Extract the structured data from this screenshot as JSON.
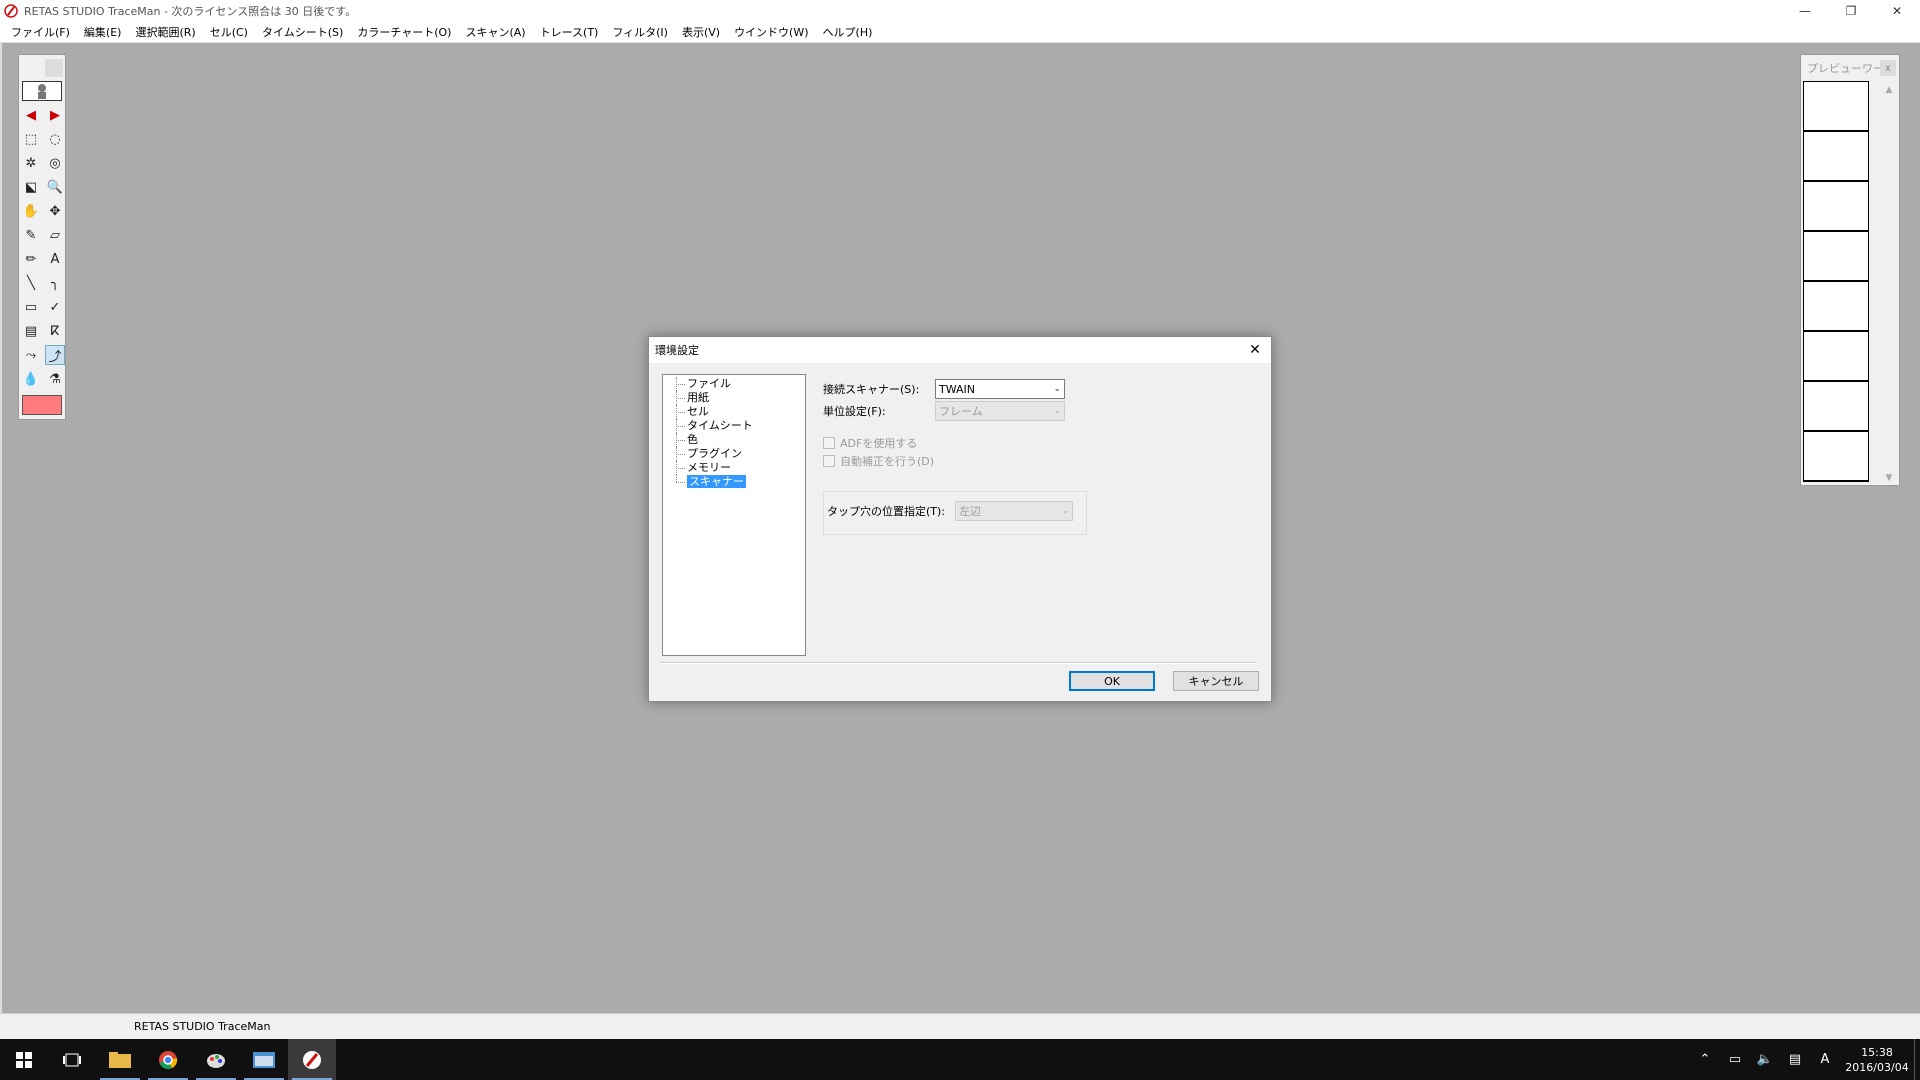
{
  "window": {
    "title": "RETAS STUDIO TraceMan - 次のライセンス照合は 30 日後です。",
    "controls": {
      "minimize": "—",
      "restore": "❐",
      "close": "✕"
    }
  },
  "menu": [
    "ファイル(F)",
    "編集(E)",
    "選択範囲(R)",
    "セル(C)",
    "タイムシート(S)",
    "カラーチャート(O)",
    "スキャン(A)",
    "トレース(T)",
    "フィルタ(I)",
    "表示(V)",
    "ウインドウ(W)",
    "ヘルプ(H)"
  ],
  "toolbox": {
    "tools": [
      "◀",
      "▶",
      "⬚",
      "◌",
      "✲",
      "◎",
      "⬕",
      "🔍",
      "✋",
      "✥",
      "✎",
      "▱",
      "✏",
      "A",
      "╲",
      "╮",
      "▭",
      "✓",
      "▤",
      "ⴽ",
      "⤳",
      "⤴",
      "💧",
      "⚗"
    ],
    "color": "#ff7b7b"
  },
  "previewer": {
    "title": "プレビューワー",
    "close": "x",
    "frame_count": 8,
    "scroll_up": "▲",
    "scroll_down": "▼"
  },
  "status": {
    "text": "RETAS STUDIO TraceMan"
  },
  "dialog": {
    "title": "環境設定",
    "close": "✕",
    "tree": [
      "ファイル",
      "用紙",
      "セル",
      "タイムシート",
      "色",
      "プラグイン",
      "メモリー",
      "スキャナー"
    ],
    "selected_index": 7,
    "scanner_label": "接続スキャナー(S):",
    "scanner_value": "TWAIN",
    "unit_label": "単位設定(F):",
    "unit_value": "フレーム",
    "adf_label": "ADFを使用する",
    "auto_label": "自動補正を行う(D)",
    "tap_label": "タップ穴の位置指定(T):",
    "tap_value": "左辺",
    "ok": "OK",
    "cancel": "キャンセル"
  },
  "taskbar": {
    "clock_time": "15:38",
    "clock_date": "2016/03/04",
    "ime": "A"
  }
}
